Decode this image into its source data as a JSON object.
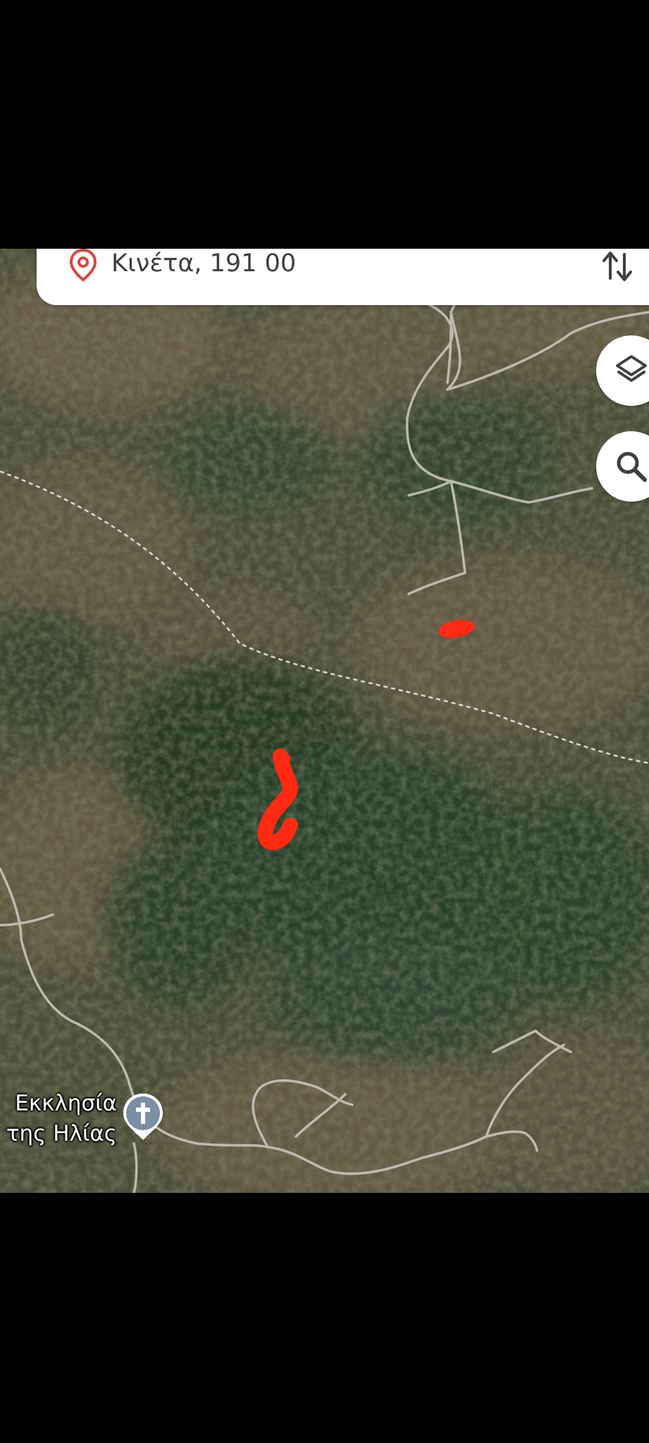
{
  "search": {
    "location_text": "Κινέτα, 191 00",
    "pin_icon": "location-pin-icon",
    "swap_icon": "swap-directions-icon"
  },
  "map": {
    "imagery": "satellite",
    "place_labels": [
      {
        "line1": "Εκκλησία",
        "line2": "της Ηλίας",
        "icon": "church-cross-icon"
      }
    ]
  },
  "controls": {
    "layers_icon": "layers-icon",
    "search_icon": "search-icon"
  },
  "colors": {
    "pin": "#d9473b",
    "annotation": "#ff2a12",
    "church_marker": "#7b8fa3",
    "road": "#c9c4bc",
    "boundary": "#e8e8e8"
  }
}
